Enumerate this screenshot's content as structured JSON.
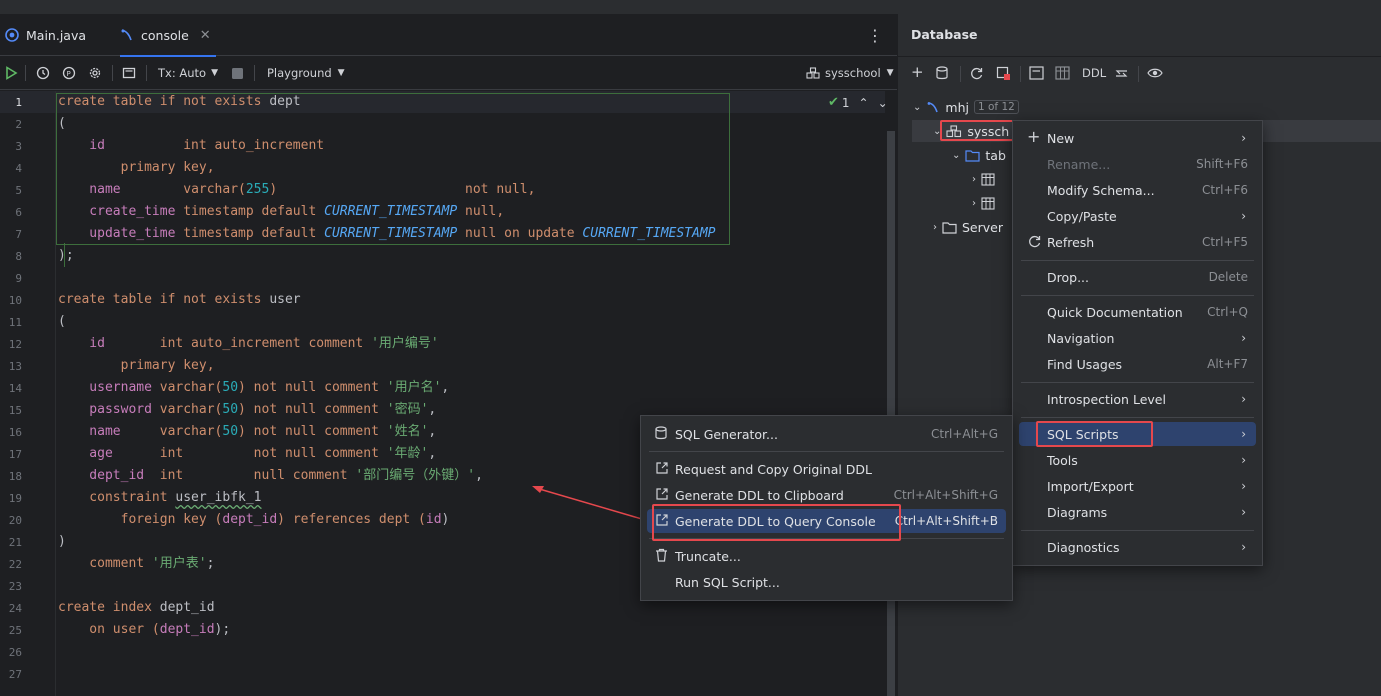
{
  "editor": {
    "tabs": [
      {
        "label": "Main.java",
        "icon": "java-class-icon"
      },
      {
        "label": "console",
        "icon": "sql-console-icon",
        "active": true
      }
    ],
    "toolbar": {
      "tx_mode": "Tx: Auto",
      "playground": "Playground",
      "schema": "sysschool"
    },
    "inspection": {
      "count": "1"
    },
    "line_numbers": [
      "1",
      "2",
      "3",
      "4",
      "5",
      "6",
      "7",
      "8",
      "9",
      "10",
      "11",
      "12",
      "13",
      "14",
      "15",
      "16",
      "17",
      "18",
      "19",
      "20",
      "21",
      "22",
      "23",
      "24",
      "25",
      "26",
      "27"
    ]
  },
  "code": {
    "l1": [
      "create table if not exists",
      " dept"
    ],
    "l2": "(",
    "l3": [
      "    id",
      "          int auto_increment"
    ],
    "l4": "        primary key,",
    "l5": [
      "    name",
      "        varchar(",
      "255",
      ")",
      "                        not null,"
    ],
    "l6": [
      "    create_time",
      " timestamp default ",
      "CURRENT_TIMESTAMP",
      " null,"
    ],
    "l7": [
      "    update_time",
      " timestamp default ",
      "CURRENT_TIMESTAMP",
      " null on update ",
      "CURRENT_TIMESTAMP"
    ],
    "l8": ");",
    "l10": [
      "create table if not exists",
      " user"
    ],
    "l11": "(",
    "l12": [
      "    id",
      "       int auto_increment comment ",
      "'用户编号'"
    ],
    "l13": "        primary key,",
    "l14": [
      "    username",
      " varchar(",
      "50",
      ") not null comment ",
      "'用户名'",
      ","
    ],
    "l15": [
      "    password",
      " varchar(",
      "50",
      ") not null comment ",
      "'密码'",
      ","
    ],
    "l16": [
      "    name",
      "     varchar(",
      "50",
      ") not null comment ",
      "'姓名'",
      ","
    ],
    "l17": [
      "    age",
      "      int         not null comment ",
      "'年龄'",
      ","
    ],
    "l18": [
      "    dept_id",
      "  int         null comment ",
      "'部门编号（外键）'",
      ","
    ],
    "l19": [
      "    constraint ",
      "user_ibfk_1"
    ],
    "l20": [
      "        foreign key (",
      "dept_id",
      ") references dept (",
      "id",
      ")"
    ],
    "l21": ")",
    "l22": [
      "    comment ",
      "'用户表'",
      ";"
    ],
    "l24": [
      "create index ",
      "dept_id"
    ],
    "l25": [
      "    on user (",
      "dept_id",
      ");"
    ]
  },
  "database": {
    "title": "Database",
    "toolbar": {
      "ddl": "DDL"
    },
    "tree": {
      "connection": "mhj",
      "badge": "1 of 12",
      "schema": "syssch",
      "folder": "tab",
      "server": "Server"
    }
  },
  "context_menu": {
    "items": [
      {
        "label": "New",
        "shortcut": ""
      },
      {
        "label": "Rename...",
        "shortcut": "Shift+F6"
      },
      {
        "label": "Modify Schema...",
        "shortcut": "Ctrl+F6"
      },
      {
        "label": "Copy/Paste",
        "shortcut": ""
      },
      {
        "label": "Refresh",
        "shortcut": "Ctrl+F5"
      },
      {
        "label": "Drop...",
        "shortcut": "Delete"
      },
      {
        "label": "Quick Documentation",
        "shortcut": "Ctrl+Q"
      },
      {
        "label": "Navigation",
        "shortcut": ""
      },
      {
        "label": "Find Usages",
        "shortcut": "Alt+F7"
      },
      {
        "label": "Introspection Level",
        "shortcut": ""
      },
      {
        "label": "SQL Scripts",
        "shortcut": ""
      },
      {
        "label": "Tools",
        "shortcut": ""
      },
      {
        "label": "Import/Export",
        "shortcut": ""
      },
      {
        "label": "Diagrams",
        "shortcut": ""
      },
      {
        "label": "Diagnostics",
        "shortcut": ""
      }
    ]
  },
  "submenu": {
    "items": [
      {
        "label": "SQL Generator...",
        "shortcut": "Ctrl+Alt+G"
      },
      {
        "label": "Request and Copy Original DDL",
        "shortcut": ""
      },
      {
        "label": "Generate DDL to Clipboard",
        "shortcut": "Ctrl+Alt+Shift+G"
      },
      {
        "label": "Generate DDL to Query Console",
        "shortcut": "Ctrl+Alt+Shift+B"
      },
      {
        "label": "Truncate...",
        "shortcut": ""
      },
      {
        "label": "Run SQL Script...",
        "shortcut": ""
      }
    ]
  },
  "colors": {
    "accent": "#3574f0",
    "selection": "#2e436e",
    "annotation": "#e5484d"
  }
}
